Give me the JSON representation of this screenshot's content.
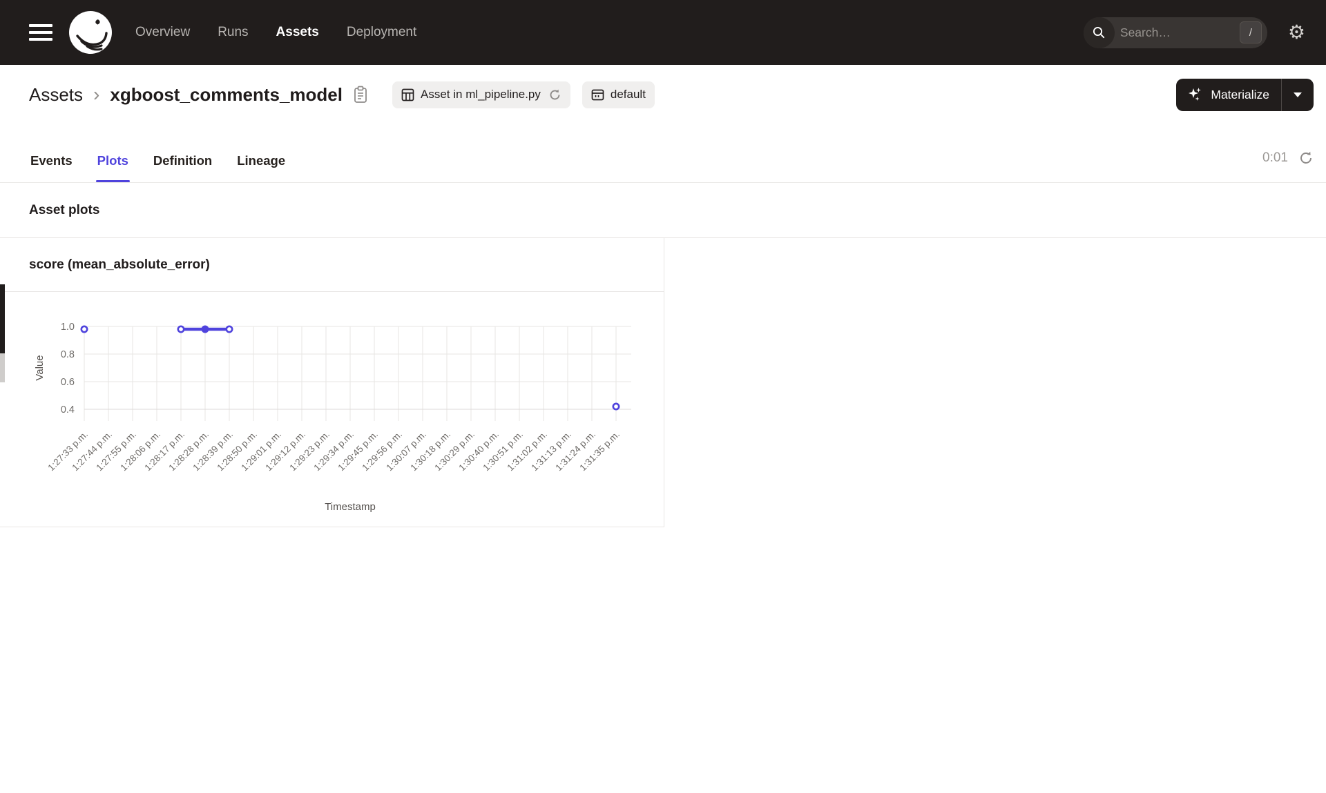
{
  "nav": {
    "items": [
      {
        "label": "Overview",
        "active": false
      },
      {
        "label": "Runs",
        "active": false
      },
      {
        "label": "Assets",
        "active": true
      },
      {
        "label": "Deployment",
        "active": false
      }
    ],
    "search": {
      "placeholder": "Search…",
      "shortcut": "/"
    }
  },
  "icons": {
    "gear": "⚙",
    "breadcrumb_separator": "›"
  },
  "page_header": {
    "breadcrumb_root": "Assets",
    "asset_name": "xgboost_comments_model",
    "tags": [
      {
        "label": "Asset in ml_pipeline.py"
      },
      {
        "label": "default"
      }
    ],
    "materialize_label": "Materialize"
  },
  "tabs": {
    "items": [
      {
        "label": "Events",
        "active": false
      },
      {
        "label": "Plots",
        "active": true
      },
      {
        "label": "Definition",
        "active": false
      },
      {
        "label": "Lineage",
        "active": false
      }
    ],
    "refresh_timer": "0:01"
  },
  "section": {
    "title": "Asset plots"
  },
  "chart_data": {
    "type": "line",
    "title": "score (mean_absolute_error)",
    "xlabel": "Timestamp",
    "ylabel": "Value",
    "x_tick_labels": [
      "1:27:33 p.m.",
      "1:27:44 p.m.",
      "1:27:55 p.m.",
      "1:28:06 p.m.",
      "1:28:17 p.m.",
      "1:28:28 p.m.",
      "1:28:39 p.m.",
      "1:28:50 p.m.",
      "1:29:01 p.m.",
      "1:29:12 p.m.",
      "1:29:23 p.m.",
      "1:29:34 p.m.",
      "1:29:45 p.m.",
      "1:29:56 p.m.",
      "1:30:07 p.m.",
      "1:30:18 p.m.",
      "1:30:29 p.m.",
      "1:30:40 p.m.",
      "1:30:51 p.m.",
      "1:31:02 p.m.",
      "1:31:13 p.m.",
      "1:31:24 p.m.",
      "1:31:35 p.m."
    ],
    "yticks": [
      1.0,
      0.8,
      0.6,
      0.4
    ],
    "ylim": [
      0.33,
      1.0
    ],
    "grid": true,
    "legend": "none",
    "series": [
      {
        "name": "score (mean_absolute_error)",
        "color": "#4F43DD",
        "values": [
          0.98,
          null,
          null,
          null,
          0.98,
          0.98,
          0.98,
          null,
          null,
          null,
          null,
          null,
          null,
          null,
          null,
          null,
          null,
          null,
          null,
          null,
          null,
          null,
          0.42
        ]
      }
    ]
  }
}
